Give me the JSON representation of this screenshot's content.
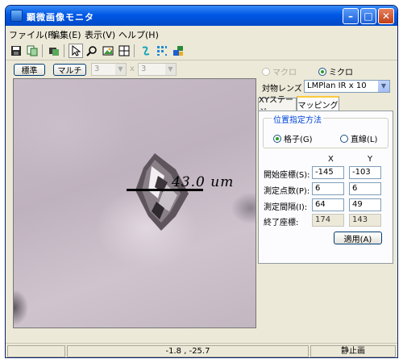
{
  "window": {
    "title": "顕微画像モニタ"
  },
  "menu": [
    "ファイル(F)",
    "編集(E)",
    "表示(V)",
    "ヘルプ(H)"
  ],
  "controls": {
    "standard_label": "標準",
    "multi_label": "マルチ",
    "grid_cols": "3",
    "grid_sep": "x",
    "grid_rows": "3"
  },
  "image": {
    "scale_text": "43.0 um"
  },
  "mode": {
    "macro_label": "マクロ",
    "micro_label": "ミクロ",
    "selected": "micro"
  },
  "objective": {
    "label": "対物レンズ :",
    "value": "LMPlan IR  x 10"
  },
  "tabs": [
    {
      "label": "XYステージ",
      "active": false
    },
    {
      "label": "マッピング",
      "active": true
    }
  ],
  "mapping": {
    "group_title": "位置指定方法",
    "grid_label": "格子(G)",
    "line_label": "直線(L)",
    "selected": "grid",
    "col_x": "X",
    "col_y": "Y",
    "rows": [
      {
        "label": "開始座標(S):",
        "x": "-145",
        "y": "-103",
        "readonly": false
      },
      {
        "label": "測定点数(P):",
        "x": "6",
        "y": "6",
        "readonly": false
      },
      {
        "label": "測定間隔(I):",
        "x": "64",
        "y": "49",
        "readonly": false
      },
      {
        "label": "終了座標:",
        "x": "174",
        "y": "143",
        "readonly": true
      }
    ],
    "apply_label": "適用(A)"
  },
  "status": {
    "coords": "-1.8 , -25.7",
    "state": "静止画"
  }
}
